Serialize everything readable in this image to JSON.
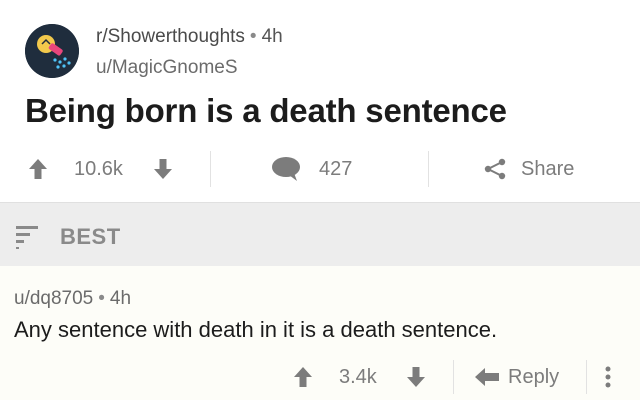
{
  "post": {
    "subreddit": "r/Showerthoughts",
    "separator": "•",
    "age": "4h",
    "author": "u/MagicGnomeS",
    "title": "Being born is a death sentence",
    "score": "10.6k",
    "comments": "427",
    "share_label": "Share"
  },
  "sort": {
    "label": "BEST"
  },
  "comment": {
    "author": "u/dq8705",
    "separator": "•",
    "age": "4h",
    "body": "Any sentence with death in it is a death sentence.",
    "score": "3.4k",
    "reply_label": "Reply"
  },
  "colors": {
    "icon_gray": "#7c7c7c",
    "sort_bar_bg": "#ededed",
    "comment_bg": "#fdfdf8",
    "avatar_bg": "#1f2d3d"
  },
  "icons": {
    "avatar": "subreddit-showerhead-icon",
    "upvote": "upvote-arrow-icon",
    "downvote": "downvote-arrow-icon",
    "comments": "speech-bubble-icon",
    "share": "share-icon",
    "sort": "sort-lines-icon",
    "reply": "reply-arrow-icon",
    "more": "more-vertical-icon"
  }
}
